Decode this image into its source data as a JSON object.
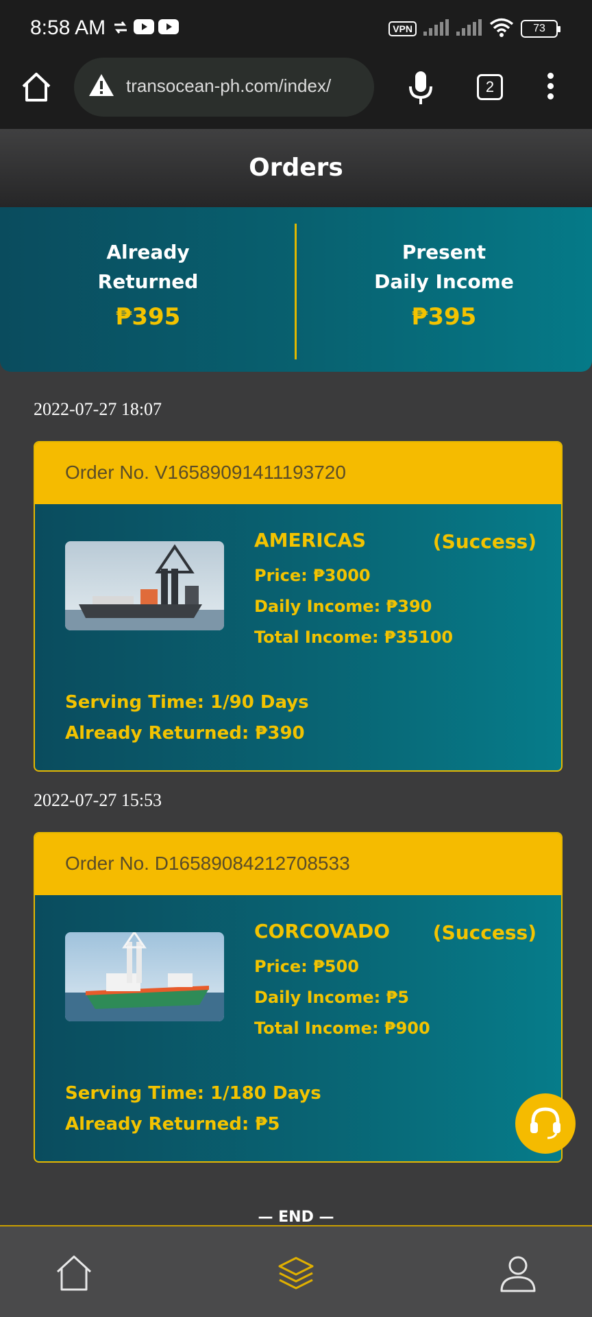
{
  "status_bar": {
    "time": "8:58 AM",
    "vpn_label": "VPN",
    "battery": "73",
    "icons": [
      "sync-icon",
      "youtube-icon",
      "youtube-icon",
      "signal-icon",
      "signal-icon",
      "wifi-icon",
      "battery-icon"
    ]
  },
  "browser": {
    "url": "transocean-ph.com/index/",
    "tab_count": "2",
    "icons": [
      "home-icon",
      "warning-icon",
      "mic-icon",
      "tabs-icon",
      "more-vert-icon"
    ]
  },
  "page": {
    "title": "Orders"
  },
  "summary": {
    "left": {
      "label_line1": "Already",
      "label_line2": "Returned",
      "amount": "₱395"
    },
    "right": {
      "label_line1": "Present",
      "label_line2": "Daily Income",
      "amount": "₱395"
    }
  },
  "orders": [
    {
      "date": "2022-07-27 18:07",
      "order_no": "Order No. V16589091411193720",
      "name": "AMERICAS",
      "status": "(Success)",
      "price": "Price: ₱3000",
      "daily_income": "Daily Income: ₱390",
      "total_income": "Total Income: ₱35100",
      "serving_time": "Serving Time: 1/90 Days",
      "already_returned": "Already Returned: ₱390"
    },
    {
      "date": "2022-07-27 15:53",
      "order_no": "Order No. D16589084212708533",
      "name": "CORCOVADO",
      "status": "(Success)",
      "price": "Price: ₱500",
      "daily_income": "Daily Income: ₱5",
      "total_income": "Total Income: ₱900",
      "serving_time": "Serving Time: 1/180 Days",
      "already_returned": "Already Returned: ₱5"
    }
  ],
  "end_marker": "— END —",
  "bottom_nav": {
    "items": [
      {
        "icon": "home-icon",
        "active": false
      },
      {
        "icon": "layers-icon",
        "active": true
      },
      {
        "icon": "user-icon",
        "active": false
      }
    ]
  },
  "colors": {
    "accent": "#f5bb00",
    "gold_text": "#f3c300",
    "teal": "#08606f",
    "background": "#3b3b3c"
  }
}
